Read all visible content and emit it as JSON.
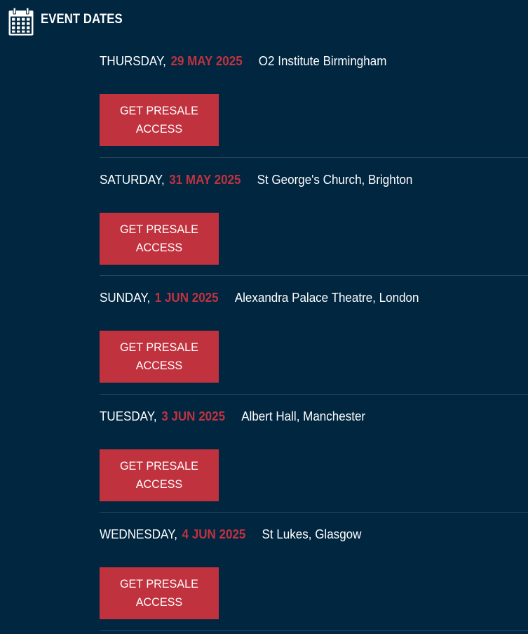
{
  "header": {
    "title": "EVENT DATES",
    "icon": "calendar-icon"
  },
  "colors": {
    "background": "#012640",
    "accent": "#c1323f",
    "divider": "#2c4860",
    "text": "#ffffff"
  },
  "events": [
    {
      "day": "THURSDAY,",
      "date": "29 MAY 2025",
      "venue": "O2 Institute Birmingham",
      "button_line1": "GET PRESALE",
      "button_line2": "ACCESS"
    },
    {
      "day": "SATURDAY,",
      "date": "31 MAY 2025",
      "venue": "St George's Church, Brighton",
      "button_line1": "GET PRESALE",
      "button_line2": "ACCESS"
    },
    {
      "day": "SUNDAY,",
      "date": "1 JUN 2025",
      "venue": "Alexandra Palace Theatre, London",
      "button_line1": "GET PRESALE",
      "button_line2": "ACCESS"
    },
    {
      "day": "TUESDAY,",
      "date": "3 JUN 2025",
      "venue": "Albert Hall, Manchester",
      "button_line1": "GET PRESALE",
      "button_line2": "ACCESS"
    },
    {
      "day": "WEDNESDAY,",
      "date": "4 JUN 2025",
      "venue": "St Lukes, Glasgow",
      "button_line1": "GET PRESALE",
      "button_line2": "ACCESS"
    }
  ]
}
